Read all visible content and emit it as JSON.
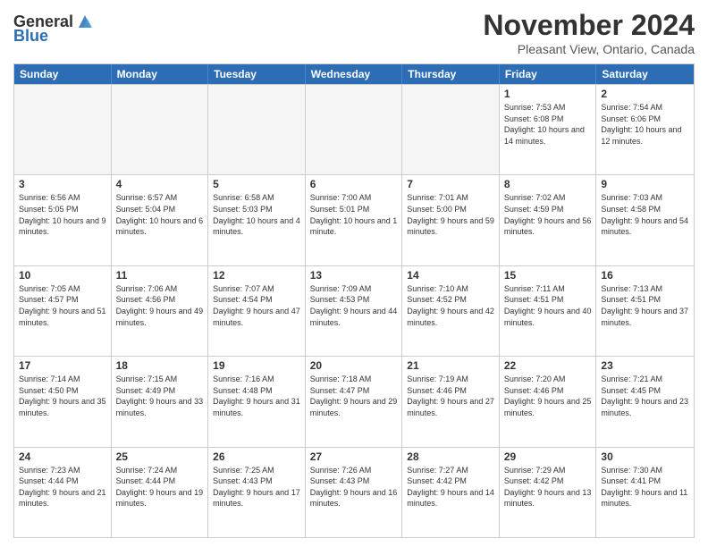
{
  "logo": {
    "line1": "General",
    "line2": "Blue"
  },
  "title": "November 2024",
  "subtitle": "Pleasant View, Ontario, Canada",
  "header_days": [
    "Sunday",
    "Monday",
    "Tuesday",
    "Wednesday",
    "Thursday",
    "Friday",
    "Saturday"
  ],
  "weeks": [
    [
      {
        "day": "",
        "info": ""
      },
      {
        "day": "",
        "info": ""
      },
      {
        "day": "",
        "info": ""
      },
      {
        "day": "",
        "info": ""
      },
      {
        "day": "",
        "info": ""
      },
      {
        "day": "1",
        "info": "Sunrise: 7:53 AM\nSunset: 6:08 PM\nDaylight: 10 hours and 14 minutes."
      },
      {
        "day": "2",
        "info": "Sunrise: 7:54 AM\nSunset: 6:06 PM\nDaylight: 10 hours and 12 minutes."
      }
    ],
    [
      {
        "day": "3",
        "info": "Sunrise: 6:56 AM\nSunset: 5:05 PM\nDaylight: 10 hours and 9 minutes."
      },
      {
        "day": "4",
        "info": "Sunrise: 6:57 AM\nSunset: 5:04 PM\nDaylight: 10 hours and 6 minutes."
      },
      {
        "day": "5",
        "info": "Sunrise: 6:58 AM\nSunset: 5:03 PM\nDaylight: 10 hours and 4 minutes."
      },
      {
        "day": "6",
        "info": "Sunrise: 7:00 AM\nSunset: 5:01 PM\nDaylight: 10 hours and 1 minute."
      },
      {
        "day": "7",
        "info": "Sunrise: 7:01 AM\nSunset: 5:00 PM\nDaylight: 9 hours and 59 minutes."
      },
      {
        "day": "8",
        "info": "Sunrise: 7:02 AM\nSunset: 4:59 PM\nDaylight: 9 hours and 56 minutes."
      },
      {
        "day": "9",
        "info": "Sunrise: 7:03 AM\nSunset: 4:58 PM\nDaylight: 9 hours and 54 minutes."
      }
    ],
    [
      {
        "day": "10",
        "info": "Sunrise: 7:05 AM\nSunset: 4:57 PM\nDaylight: 9 hours and 51 minutes."
      },
      {
        "day": "11",
        "info": "Sunrise: 7:06 AM\nSunset: 4:56 PM\nDaylight: 9 hours and 49 minutes."
      },
      {
        "day": "12",
        "info": "Sunrise: 7:07 AM\nSunset: 4:54 PM\nDaylight: 9 hours and 47 minutes."
      },
      {
        "day": "13",
        "info": "Sunrise: 7:09 AM\nSunset: 4:53 PM\nDaylight: 9 hours and 44 minutes."
      },
      {
        "day": "14",
        "info": "Sunrise: 7:10 AM\nSunset: 4:52 PM\nDaylight: 9 hours and 42 minutes."
      },
      {
        "day": "15",
        "info": "Sunrise: 7:11 AM\nSunset: 4:51 PM\nDaylight: 9 hours and 40 minutes."
      },
      {
        "day": "16",
        "info": "Sunrise: 7:13 AM\nSunset: 4:51 PM\nDaylight: 9 hours and 37 minutes."
      }
    ],
    [
      {
        "day": "17",
        "info": "Sunrise: 7:14 AM\nSunset: 4:50 PM\nDaylight: 9 hours and 35 minutes."
      },
      {
        "day": "18",
        "info": "Sunrise: 7:15 AM\nSunset: 4:49 PM\nDaylight: 9 hours and 33 minutes."
      },
      {
        "day": "19",
        "info": "Sunrise: 7:16 AM\nSunset: 4:48 PM\nDaylight: 9 hours and 31 minutes."
      },
      {
        "day": "20",
        "info": "Sunrise: 7:18 AM\nSunset: 4:47 PM\nDaylight: 9 hours and 29 minutes."
      },
      {
        "day": "21",
        "info": "Sunrise: 7:19 AM\nSunset: 4:46 PM\nDaylight: 9 hours and 27 minutes."
      },
      {
        "day": "22",
        "info": "Sunrise: 7:20 AM\nSunset: 4:46 PM\nDaylight: 9 hours and 25 minutes."
      },
      {
        "day": "23",
        "info": "Sunrise: 7:21 AM\nSunset: 4:45 PM\nDaylight: 9 hours and 23 minutes."
      }
    ],
    [
      {
        "day": "24",
        "info": "Sunrise: 7:23 AM\nSunset: 4:44 PM\nDaylight: 9 hours and 21 minutes."
      },
      {
        "day": "25",
        "info": "Sunrise: 7:24 AM\nSunset: 4:44 PM\nDaylight: 9 hours and 19 minutes."
      },
      {
        "day": "26",
        "info": "Sunrise: 7:25 AM\nSunset: 4:43 PM\nDaylight: 9 hours and 17 minutes."
      },
      {
        "day": "27",
        "info": "Sunrise: 7:26 AM\nSunset: 4:43 PM\nDaylight: 9 hours and 16 minutes."
      },
      {
        "day": "28",
        "info": "Sunrise: 7:27 AM\nSunset: 4:42 PM\nDaylight: 9 hours and 14 minutes."
      },
      {
        "day": "29",
        "info": "Sunrise: 7:29 AM\nSunset: 4:42 PM\nDaylight: 9 hours and 13 minutes."
      },
      {
        "day": "30",
        "info": "Sunrise: 7:30 AM\nSunset: 4:41 PM\nDaylight: 9 hours and 11 minutes."
      }
    ]
  ]
}
